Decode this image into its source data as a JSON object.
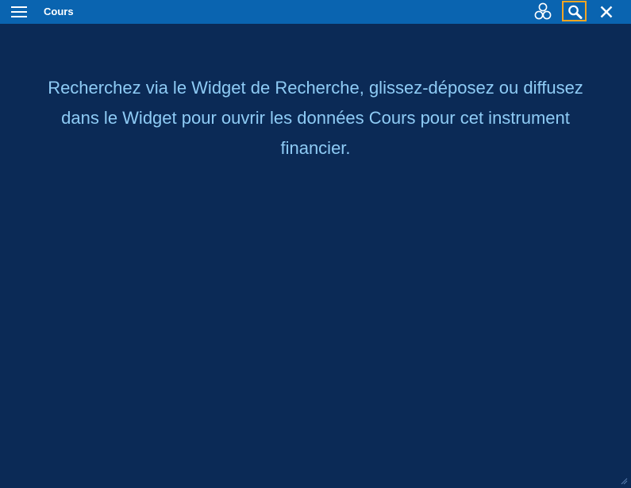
{
  "window": {
    "title": "Cours"
  },
  "toolbar": {
    "icons": {
      "menu": "hamburger-menu-icon",
      "linked": "linked-circles-icon",
      "search": "search-icon",
      "close": "close-icon"
    }
  },
  "main": {
    "message": "Recherchez via le Widget de Recherche, glissez-déposez ou diffusez dans le Widget pour ouvrir les données Cours pour cet instrument financier."
  },
  "colors": {
    "titlebar": "#0a64b0",
    "background": "#0b2a56",
    "message_text": "#8ecbf5",
    "highlight": "#f5a623"
  }
}
